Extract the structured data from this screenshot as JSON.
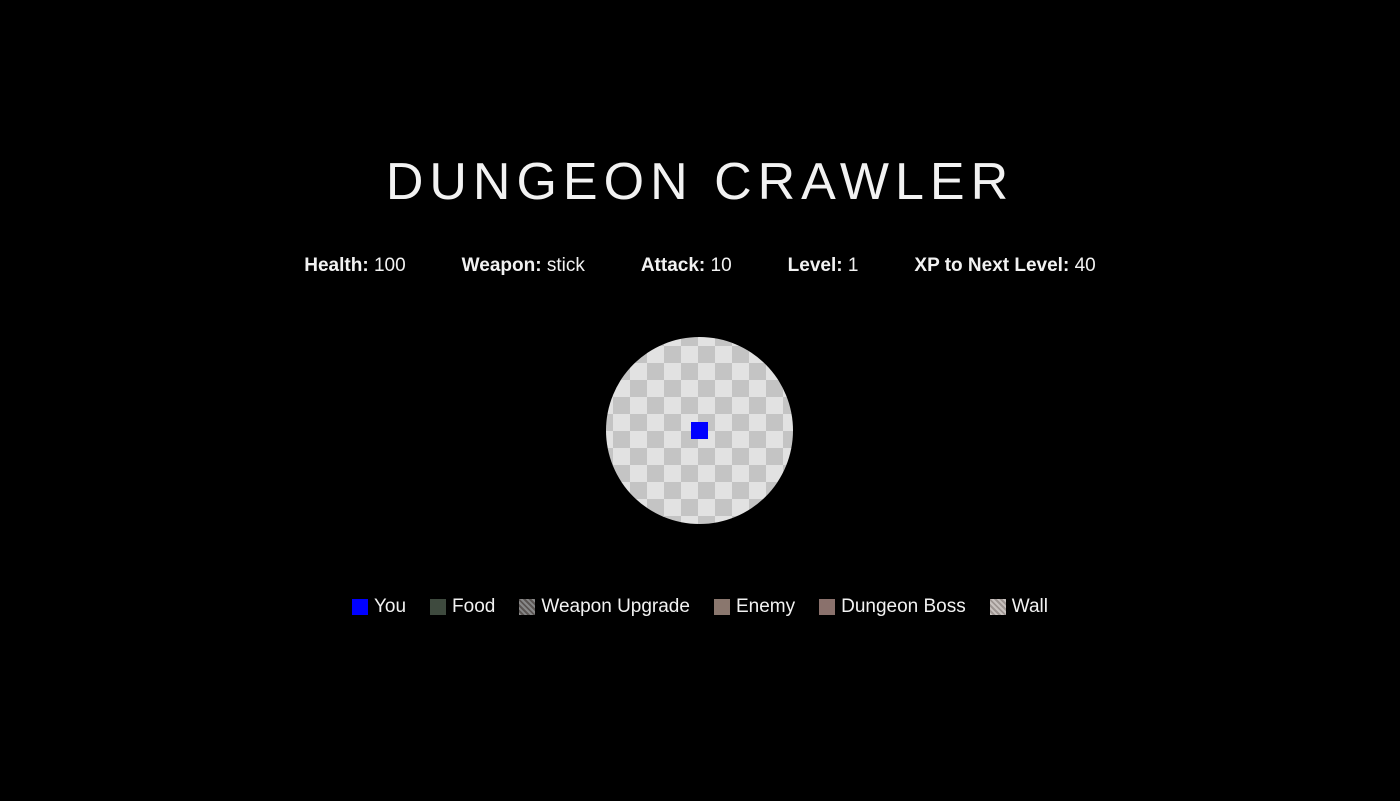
{
  "title": "DUNGEON CRAWLER",
  "stats": [
    {
      "label": "Health:",
      "value": "100"
    },
    {
      "label": "Weapon:",
      "value": "stick"
    },
    {
      "label": "Attack:",
      "value": "10"
    },
    {
      "label": "Level:",
      "value": "1"
    },
    {
      "label": "XP to Next Level:",
      "value": "40"
    }
  ],
  "board": {
    "player_icon": "blue-square",
    "floor_pattern": "checkerboard"
  },
  "legend": [
    {
      "label": "You",
      "color": "#0000ff",
      "icon": "you-swatch-icon"
    },
    {
      "label": "Food",
      "color": "#3e4a3e",
      "icon": "food-swatch-icon"
    },
    {
      "label": "Weapon Upgrade",
      "color": "#6a6461",
      "icon": "weapon-upgrade-swatch-icon"
    },
    {
      "label": "Enemy",
      "color": "#8a776e",
      "icon": "enemy-swatch-icon"
    },
    {
      "label": "Dungeon Boss",
      "color": "#8a716c",
      "icon": "dungeon-boss-swatch-icon"
    },
    {
      "label": "Wall",
      "color": "#b3aba8",
      "icon": "wall-swatch-icon"
    }
  ],
  "colors": {
    "background": "#000000",
    "text": "#f2f2f2",
    "player": "#0000ff"
  }
}
